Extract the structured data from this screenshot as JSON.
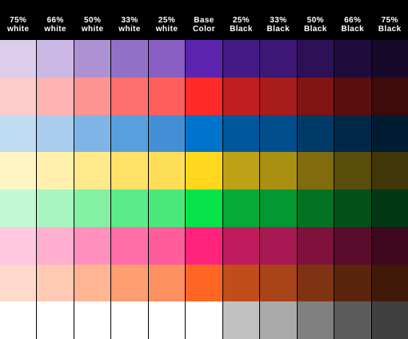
{
  "headers": [
    "75%\nwhite",
    "66%\nwhite",
    "50%\nwhite",
    "33%\nwhite",
    "25%\nwhite",
    "Base\nColor",
    "25%\nBlack",
    "33%\nBlack",
    "50%\nBlack",
    "66%\nBlack",
    "75%\nBlack"
  ],
  "rows": [
    {
      "name": "purple",
      "colors": [
        "#dbcdeb",
        "#cbb7e3",
        "#ae91d3",
        "#9270c7",
        "#8a5fc3",
        "#5b23ae",
        "#451a85",
        "#3e1777",
        "#2d1055",
        "#200c3c",
        "#170929"
      ]
    },
    {
      "name": "red",
      "colors": [
        "#fecbcb",
        "#feb3b3",
        "#fe9393",
        "#fe6f6e",
        "#fe5e5c",
        "#fe2b29",
        "#bf1f1f",
        "#a81c1c",
        "#801414",
        "#5a0e0e",
        "#3e0a0a"
      ]
    },
    {
      "name": "blue",
      "colors": [
        "#c0dcf3",
        "#a8cdee",
        "#7fb5e6",
        "#58a0dd",
        "#428fd6",
        "#0073cc",
        "#00579c",
        "#004f8c",
        "#003a66",
        "#002949",
        "#001c33"
      ]
    },
    {
      "name": "yellow",
      "colors": [
        "#fff4c4",
        "#fff0ad",
        "#ffe98a",
        "#ffe168",
        "#ffde57",
        "#ffd81e",
        "#bfa118",
        "#a99012",
        "#806c0f",
        "#5a4c0a",
        "#403608"
      ]
    },
    {
      "name": "green",
      "colors": [
        "#c2f8d3",
        "#a9f5c1",
        "#83f0a4",
        "#5ceb88",
        "#48e87a",
        "#07e449",
        "#06ab37",
        "#059732",
        "#047223",
        "#035119",
        "#023914"
      ]
    },
    {
      "name": "pink",
      "colors": [
        "#ffc8df",
        "#ffb0d0",
        "#ff8fbc",
        "#ff6ea7",
        "#ff5c9c",
        "#ff237c",
        "#c01b5e",
        "#a81852",
        "#80113d",
        "#5a0c2c",
        "#3f081f"
      ]
    },
    {
      "name": "orange",
      "colors": [
        "#ffdacb",
        "#ffcab3",
        "#ffb493",
        "#ff9e71",
        "#ff9060",
        "#ff6623",
        "#c04d1a",
        "#a84417",
        "#803312",
        "#5a240d",
        "#401909"
      ]
    },
    {
      "name": "gray",
      "colors": [
        "#ffffff",
        "#ffffff",
        "#ffffff",
        "#ffffff",
        "#ffffff",
        "#ffffff",
        "#c0c0c0",
        "#aaaaaa",
        "#808080",
        "#5b5b5b",
        "#404040"
      ]
    }
  ]
}
